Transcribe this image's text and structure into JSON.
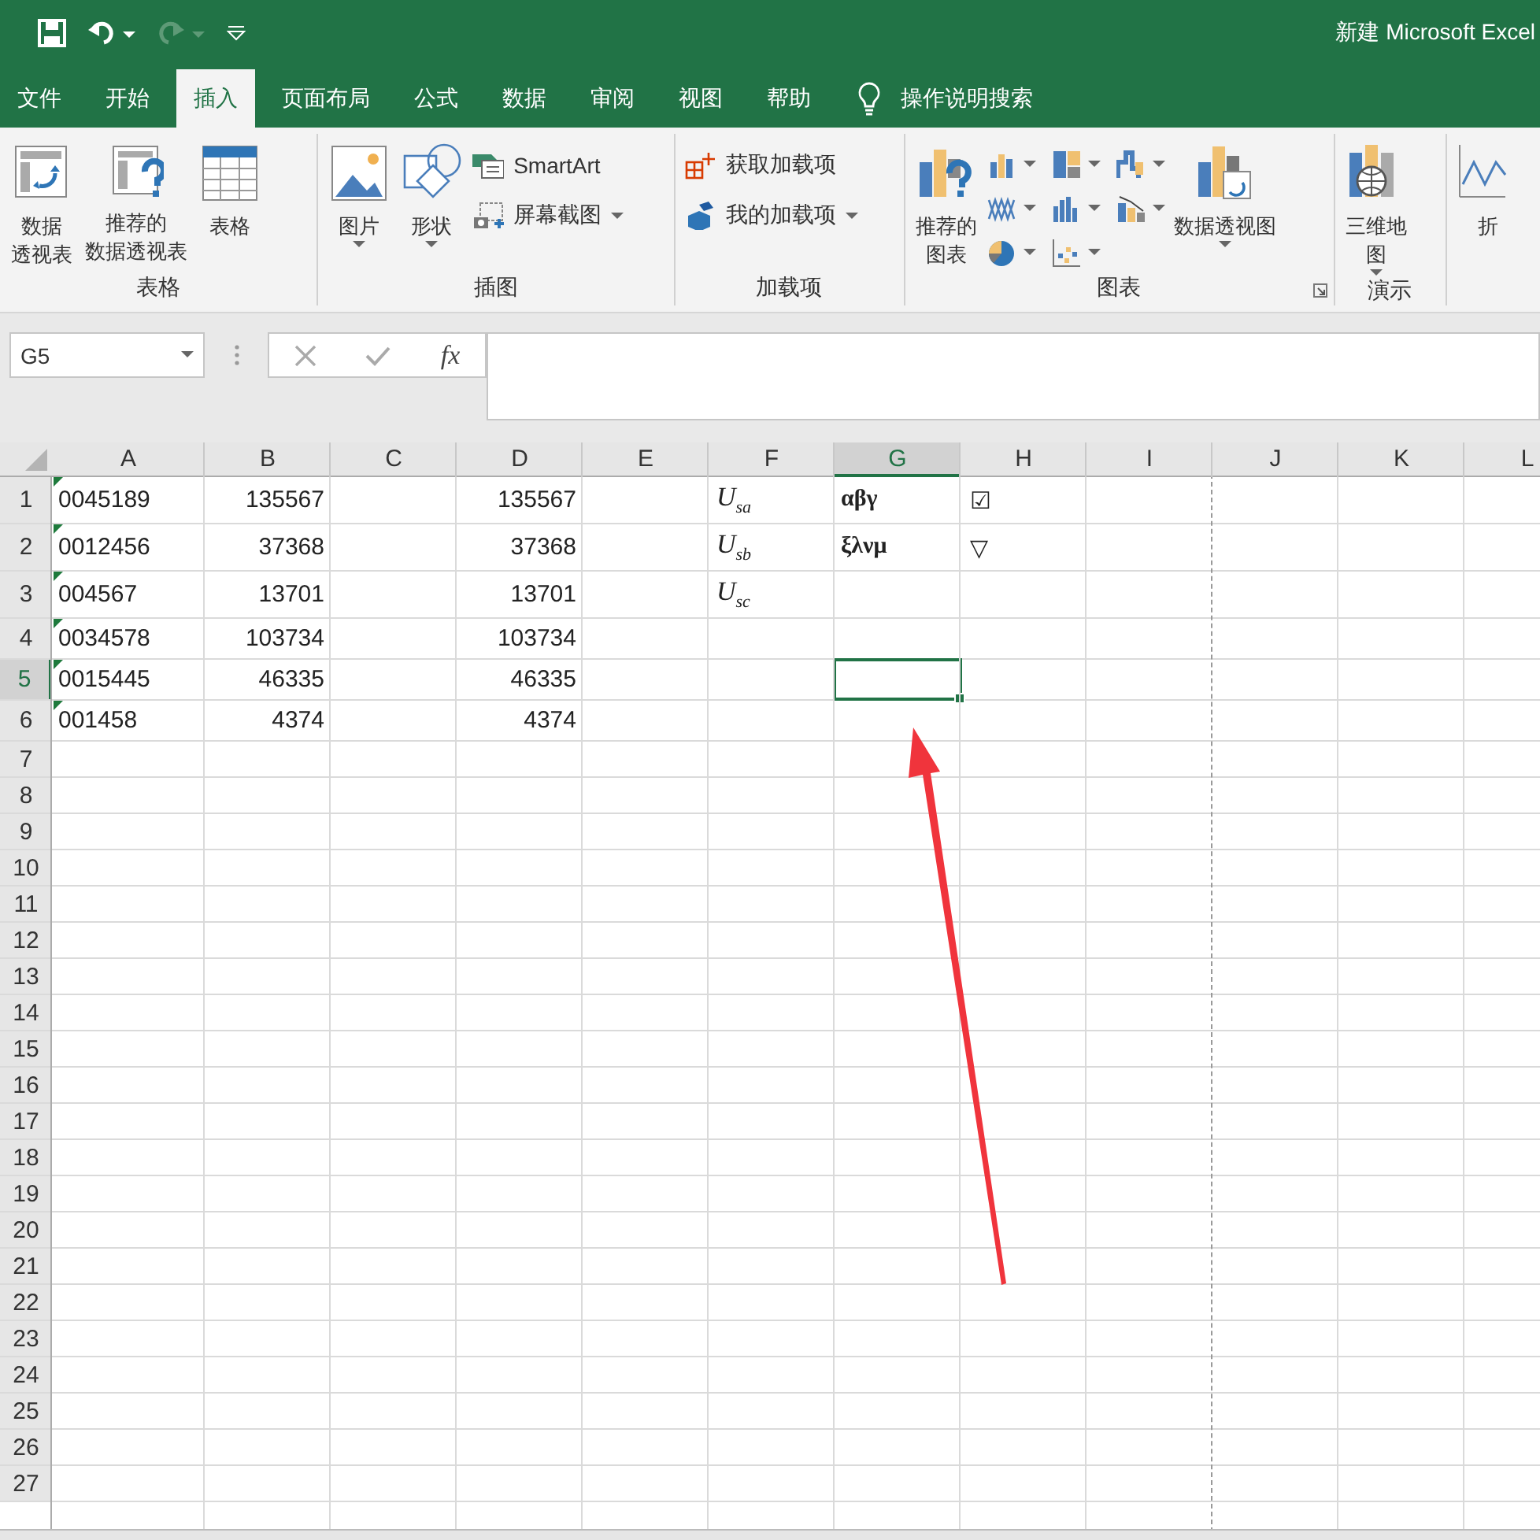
{
  "window": {
    "title": "新建 Microsoft Excel",
    "redo_disabled": true
  },
  "tabs": [
    {
      "label": "文件",
      "selected": false
    },
    {
      "label": "开始",
      "selected": false
    },
    {
      "label": "插入",
      "selected": true
    },
    {
      "label": "页面布局",
      "selected": false
    },
    {
      "label": "公式",
      "selected": false
    },
    {
      "label": "数据",
      "selected": false
    },
    {
      "label": "审阅",
      "selected": false
    },
    {
      "label": "视图",
      "selected": false
    },
    {
      "label": "帮助",
      "selected": false
    }
  ],
  "search": {
    "label": "操作说明搜索"
  },
  "ribbon": [
    {
      "label": "表格",
      "buttons": [
        {
          "kind": "large",
          "lines": [
            "数据",
            "透视表"
          ],
          "dropdown": false
        },
        {
          "kind": "large",
          "lines": [
            "推荐的",
            "数据透视表"
          ],
          "dropdown": false
        },
        {
          "kind": "large",
          "lines": [
            "表格"
          ],
          "dropdown": false
        }
      ]
    },
    {
      "label": "插图",
      "buttons": [
        {
          "kind": "large",
          "lines": [
            "图片"
          ],
          "dropdown": true
        },
        {
          "kind": "large",
          "lines": [
            "形状"
          ],
          "dropdown": true
        },
        {
          "kind": "small",
          "lines": [
            "SmartArt"
          ],
          "dropdown": false
        },
        {
          "kind": "small",
          "lines": [
            "屏幕截图"
          ],
          "dropdown": true
        }
      ]
    },
    {
      "label": "加载项",
      "buttons": [
        {
          "kind": "small",
          "lines": [
            "获取加载项"
          ],
          "dropdown": false
        },
        {
          "kind": "small",
          "lines": [
            "我的加载项"
          ],
          "dropdown": true
        }
      ]
    },
    {
      "label": "图表",
      "launcher": true,
      "buttons": [
        {
          "kind": "large",
          "lines": [
            "推荐的",
            "图表"
          ],
          "dropdown": false
        },
        {
          "kind": "icon",
          "dropdown": true
        },
        {
          "kind": "icon",
          "dropdown": true
        },
        {
          "kind": "icon",
          "dropdown": true
        },
        {
          "kind": "icon",
          "dropdown": true
        },
        {
          "kind": "icon",
          "dropdown": true
        },
        {
          "kind": "icon",
          "dropdown": true
        },
        {
          "kind": "icon",
          "dropdown": true
        },
        {
          "kind": "icon",
          "dropdown": true
        },
        {
          "kind": "large",
          "lines": [
            "数据透视图"
          ],
          "dropdown": true
        }
      ]
    },
    {
      "label": "演示",
      "buttons": [
        {
          "kind": "large",
          "lines": [
            "三维地",
            "图"
          ],
          "dropdown": true
        }
      ]
    },
    {
      "buttons": [
        {
          "kind": "large",
          "lines": [
            "折"
          ],
          "dropdown": false
        }
      ]
    }
  ],
  "formula_bar": {
    "name_box": "G5",
    "fx": "fx"
  },
  "columns": [
    {
      "label": "A",
      "kind": "text",
      "selected": false
    },
    {
      "label": "B",
      "kind": "number",
      "selected": false
    },
    {
      "label": "C",
      "kind": "number",
      "selected": false
    },
    {
      "label": "D",
      "kind": "number",
      "selected": false
    },
    {
      "label": "E",
      "kind": "number",
      "selected": false
    },
    {
      "label": "F",
      "kind": "math",
      "selected": false
    },
    {
      "label": "G",
      "kind": "greek",
      "selected": true
    },
    {
      "label": "H",
      "kind": "symbol",
      "selected": false
    },
    {
      "label": "I",
      "kind": "number",
      "selected": false
    },
    {
      "label": "J",
      "kind": "number",
      "selected": false
    },
    {
      "label": "K",
      "kind": "number",
      "selected": false
    },
    {
      "label": "L",
      "kind": "number",
      "selected": false
    }
  ],
  "rows": [
    {
      "number": "1",
      "selected": false,
      "text_flag": true,
      "cells": {
        "A": "0045189",
        "B": "135567",
        "D": "135567",
        "F": "U$_{sa}$",
        "G": "αβγ",
        "H": "☑"
      }
    },
    {
      "number": "2",
      "selected": false,
      "text_flag": true,
      "cells": {
        "A": "0012456",
        "B": "37368",
        "D": "37368",
        "F": "U$_{sb}$",
        "G": "ξλνμ",
        "H": "▽"
      }
    },
    {
      "number": "3",
      "selected": false,
      "text_flag": true,
      "cells": {
        "A": "004567",
        "B": "13701",
        "D": "13701",
        "F": "U$_{sc}$"
      }
    },
    {
      "number": "4",
      "selected": false,
      "text_flag": true,
      "cells": {
        "A": "0034578",
        "B": "103734",
        "D": "103734"
      }
    },
    {
      "number": "5",
      "selected": true,
      "text_flag": true,
      "cells": {
        "A": "0015445",
        "B": "46335",
        "D": "46335"
      }
    },
    {
      "number": "6",
      "selected": false,
      "text_flag": true,
      "cells": {
        "A": "001458",
        "B": "4374",
        "D": "4374"
      }
    },
    {
      "number": "7",
      "selected": false,
      "text_flag": false,
      "cells": {}
    },
    {
      "number": "8",
      "selected": false,
      "text_flag": false,
      "cells": {}
    },
    {
      "number": "9",
      "selected": false,
      "text_flag": false,
      "cells": {}
    },
    {
      "number": "10",
      "selected": false,
      "text_flag": false,
      "cells": {}
    },
    {
      "number": "11",
      "selected": false,
      "text_flag": false,
      "cells": {}
    },
    {
      "number": "12",
      "selected": false,
      "text_flag": false,
      "cells": {}
    },
    {
      "number": "13",
      "selected": false,
      "text_flag": false,
      "cells": {}
    },
    {
      "number": "14",
      "selected": false,
      "text_flag": false,
      "cells": {}
    },
    {
      "number": "15",
      "selected": false,
      "text_flag": false,
      "cells": {}
    },
    {
      "number": "16",
      "selected": false,
      "text_flag": false,
      "cells": {}
    },
    {
      "number": "17",
      "selected": false,
      "text_flag": false,
      "cells": {}
    },
    {
      "number": "18",
      "selected": false,
      "text_flag": false,
      "cells": {}
    },
    {
      "number": "19",
      "selected": false,
      "text_flag": false,
      "cells": {}
    },
    {
      "number": "20",
      "selected": false,
      "text_flag": false,
      "cells": {}
    },
    {
      "number": "21",
      "selected": false,
      "text_flag": false,
      "cells": {}
    },
    {
      "number": "22",
      "selected": false,
      "text_flag": false,
      "cells": {}
    },
    {
      "number": "23",
      "selected": false,
      "text_flag": false,
      "cells": {}
    },
    {
      "number": "24",
      "selected": false,
      "text_flag": false,
      "cells": {}
    },
    {
      "number": "25",
      "selected": false,
      "text_flag": false,
      "cells": {}
    },
    {
      "number": "26",
      "selected": false,
      "text_flag": false,
      "cells": {}
    },
    {
      "number": "27",
      "selected": false,
      "text_flag": false,
      "cells": {}
    }
  ]
}
